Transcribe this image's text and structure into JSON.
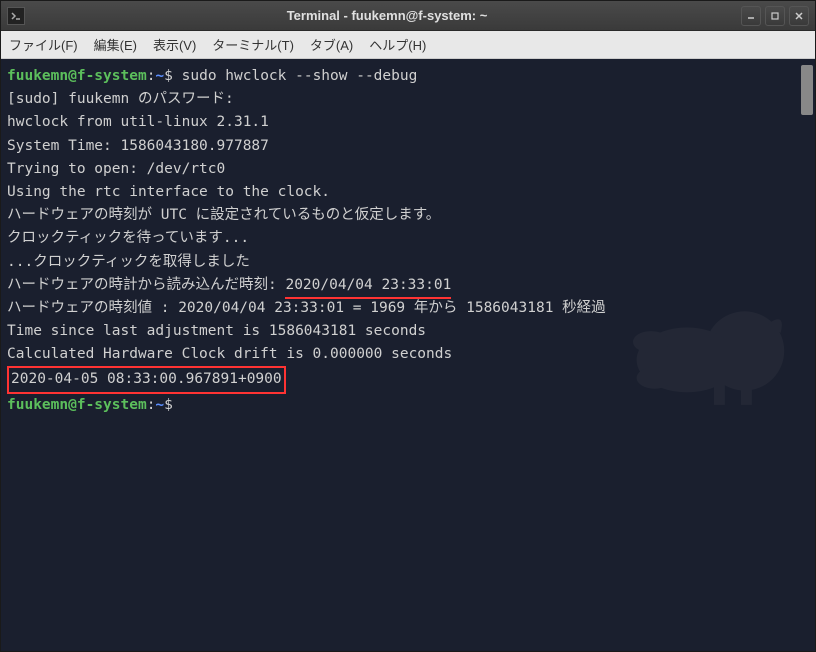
{
  "titlebar": {
    "title": "Terminal - fuukemn@f-system: ~"
  },
  "menubar": {
    "file": "ファイル(F)",
    "edit": "編集(E)",
    "view": "表示(V)",
    "terminal": "ターミナル(T)",
    "tabs": "タブ(A)",
    "help": "ヘルプ(H)"
  },
  "terminal": {
    "prompt1_user": "fuukemn@f-system",
    "prompt1_colon": ":",
    "prompt1_path": "~",
    "prompt1_dollar": "$ ",
    "command1": "sudo hwclock --show --debug",
    "line2": "[sudo] fuukemn のパスワード:",
    "line3": "hwclock from util-linux 2.31.1",
    "line4": "System Time: 1586043180.977887",
    "line5": "Trying to open: /dev/rtc0",
    "line6": "Using the rtc interface to the clock.",
    "line7": "ハードウェアの時刻が UTC に設定されているものと仮定します。",
    "line8": "クロックティックを待っています...",
    "line9": "...クロックティックを取得しました",
    "line10_prefix": "ハードウェアの時計から読み込んだ時刻: ",
    "line10_highlight": "2020/04/04 23:33:01",
    "line11": "ハードウェアの時刻値 : 2020/04/04 23:33:01 = 1969 年から 1586043181 秒経過",
    "line12": "Time since last adjustment is 1586043181 seconds",
    "line13": "Calculated Hardware Clock drift is 0.000000 seconds",
    "line14_boxed": "2020-04-05 08:33:00.967891+0900",
    "prompt2_user": "fuukemn@f-system",
    "prompt2_colon": ":",
    "prompt2_path": "~",
    "prompt2_dollar": "$"
  }
}
